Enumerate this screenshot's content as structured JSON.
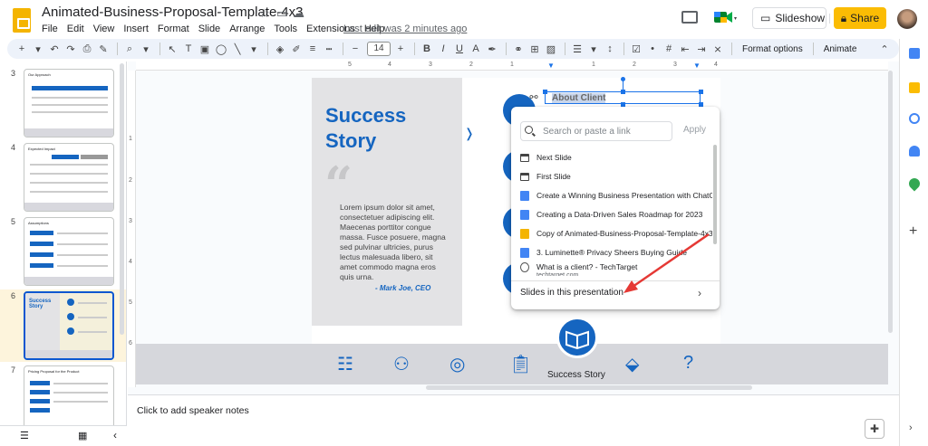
{
  "app": {
    "title": "Animated-Business-Proposal-Template-4x3",
    "last_edit": "Last edit was 2 minutes ago",
    "menu": [
      "File",
      "Edit",
      "View",
      "Insert",
      "Format",
      "Slide",
      "Arrange",
      "Tools",
      "Extensions",
      "Help"
    ],
    "slideshow_label": "Slideshow",
    "share_label": "Share"
  },
  "toolbar": {
    "font_size": "14",
    "format_options": "Format options",
    "animate": "Animate"
  },
  "filmstrip": {
    "slides": [
      {
        "num": "3",
        "title": "Our Approach"
      },
      {
        "num": "4",
        "title": "Expected Impact"
      },
      {
        "num": "5",
        "title": "Assumptions"
      },
      {
        "num": "6",
        "title": "Success Story"
      },
      {
        "num": "7",
        "title": "Pricing Proposal for the Product"
      }
    ],
    "selected": "6"
  },
  "rulers": {
    "top": [
      "5",
      "4",
      "3",
      "2",
      "1",
      "1",
      "2",
      "3",
      "4"
    ],
    "left": [
      "1",
      "2",
      "3",
      "4",
      "5",
      "6"
    ]
  },
  "slide": {
    "title_line1": "Success",
    "title_line2": "Story",
    "quote_mark": "“",
    "quote": "Lorem ipsum dolor sit amet, consectetuer adipiscing elit. Maecenas porttitor congue massa. Fusce posuere, magna sed pulvinar ultricies, purus lectus malesuada libero, sit amet commodo magna eros quis urna.",
    "author": "- Mark Joe, CEO",
    "selected_text": "About Client",
    "band_label": "Success Story"
  },
  "link_popup": {
    "search_placeholder": "Search or paste a link",
    "apply_label": "Apply",
    "suggestions": [
      {
        "type": "slide",
        "label": "Next Slide"
      },
      {
        "type": "slide",
        "label": "First Slide"
      },
      {
        "type": "doc",
        "label": "Create a Winning Business Presentation with ChatG..."
      },
      {
        "type": "doc",
        "label": "Creating a Data-Driven Sales Roadmap for 2023"
      },
      {
        "type": "presentation",
        "label": "Copy of Animated-Business-Proposal-Template-4x3"
      },
      {
        "type": "doc",
        "label": "3. Luminette® Privacy Sheers Buying Guide"
      },
      {
        "type": "web",
        "label": "What is a client? - TechTarget",
        "sub": "techtarget.com"
      }
    ],
    "slides_in_presentation": "Slides in this presentation"
  },
  "notes": {
    "placeholder": "Click to add speaker notes"
  },
  "colors": {
    "brand_blue": "#1565c0",
    "share_yellow": "#fbbc04",
    "annotation_red": "#e53935"
  }
}
